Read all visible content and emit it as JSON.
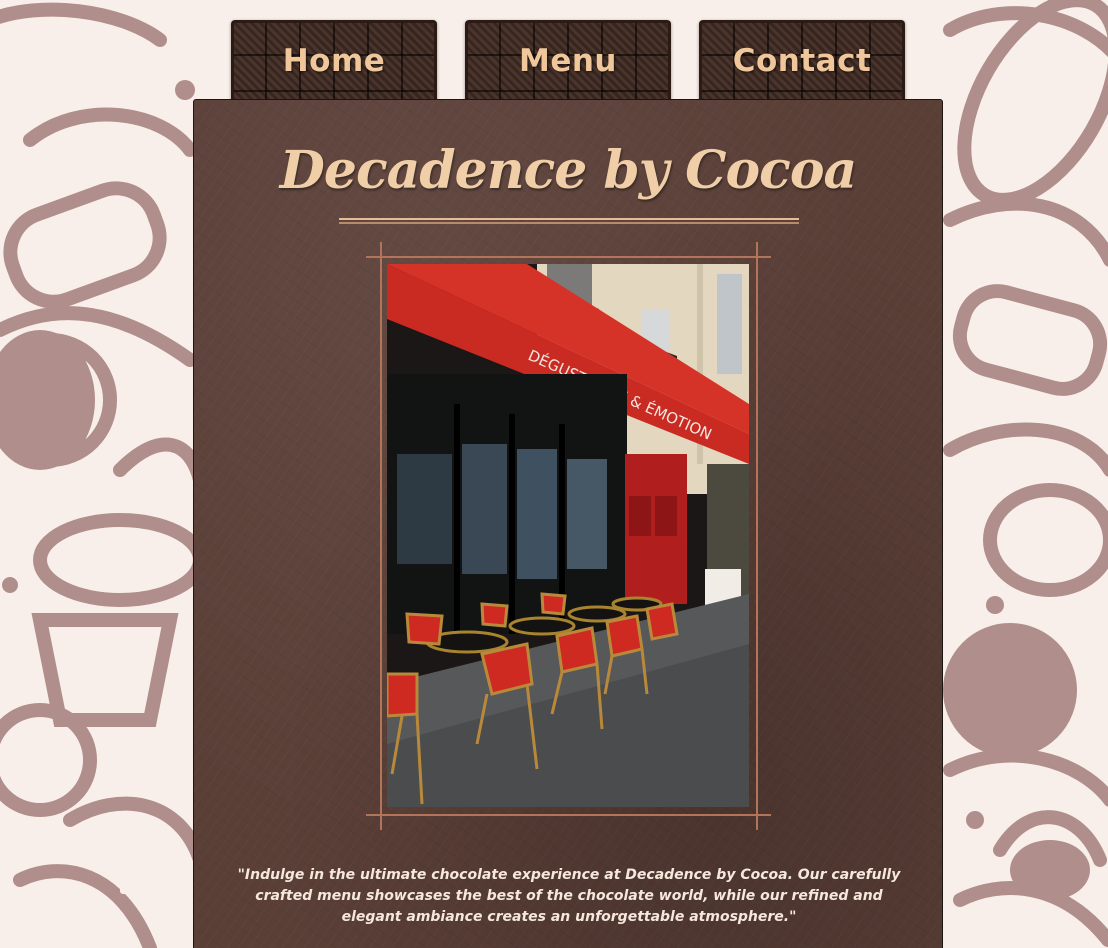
{
  "nav": {
    "home_label": "Home",
    "menu_label": "Menu",
    "contact_label": "Contact"
  },
  "header": {
    "title": "Decadence by Cocoa"
  },
  "hero_photo": {
    "awning_text": "DÉGUSTATION & ÉMOTION"
  },
  "tagline": "\"Indulge in the ultimate chocolate experience at Decadence by Cocoa. Our carefully crafted menu showcases the best of the chocolate world, while our refined and elegant ambiance creates an unforgettable atmosphere.\"",
  "colors": {
    "page_bg": "#f8efea",
    "pattern": "#b08e8b",
    "panel_bg": "#5a3f37",
    "chocolate_tab": "#3f2a22",
    "title_gold": "#f0cfa8",
    "frame_copper": "#b2755a"
  }
}
